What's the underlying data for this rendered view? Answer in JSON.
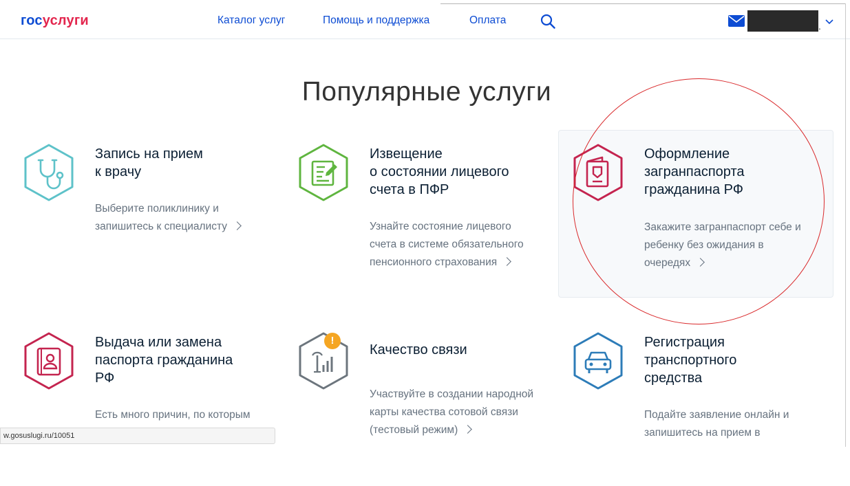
{
  "header": {
    "logo_part1": "гос",
    "logo_part2": "услуги",
    "nav": [
      "Каталог услуг",
      "Помощь и поддержка",
      "Оплата"
    ],
    "user_suffix": "."
  },
  "page_title": "Популярные услуги",
  "cards": [
    {
      "title": "Запись на прием к врачу",
      "title_lines": [
        "Запись на прием",
        "к врачу"
      ],
      "desc_lines": [
        "Выберите поликлинику и",
        "запишитесь к специалисту"
      ],
      "icon": "stethoscope-icon",
      "color": "#5ec2c9"
    },
    {
      "title_lines": [
        "Извещение",
        "о состоянии лицевого",
        "счета в ПФР"
      ],
      "desc_lines": [
        "Узнайте состояние лицевого",
        "счета в системе обязательного",
        "пенсионного страхования"
      ],
      "icon": "document-edit-icon",
      "color": "#5fb53f"
    },
    {
      "title_lines": [
        "Оформление",
        "загранпаспорта",
        "гражданина РФ"
      ],
      "desc_lines": [
        "Закажите загранпаспорт себе и",
        "ребенку без ожидания в",
        "очередях"
      ],
      "icon": "passport-icon",
      "color": "#c4244f"
    },
    {
      "title_lines": [
        "Выдача или замена",
        "паспорта гражданина",
        "РФ"
      ],
      "desc_lines": [
        "Есть много причин, по которым"
      ],
      "icon": "id-passport-icon",
      "color": "#c4244f"
    },
    {
      "title_lines": [
        "Качество связи"
      ],
      "desc_lines": [
        "Участвуйте в создании народной",
        "карты качества сотовой связи",
        "(тестовый режим)"
      ],
      "icon": "signal-tower-icon",
      "color": "#6c757d",
      "badge": "!"
    },
    {
      "title_lines": [
        "Регистрация",
        "транспортного",
        "средства"
      ],
      "desc_lines": [
        "Подайте заявление онлайн и",
        "запишитесь на прием в"
      ],
      "icon": "car-icon",
      "color": "#2d7cb8"
    }
  ],
  "status_bar_url": "w.gosuslugi.ru/10051",
  "colors": {
    "brand_blue": "#0d4cd3",
    "brand_red": "#e3264e",
    "annotation_red": "#d9282a"
  }
}
